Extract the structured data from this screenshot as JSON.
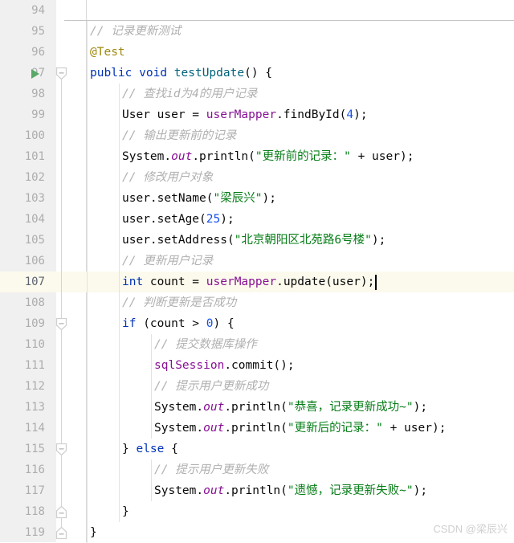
{
  "editor": {
    "language": "java",
    "theme": "IntelliJ Light",
    "current_line": 107,
    "first_visible_line": 94,
    "last_visible_line": 119,
    "colors": {
      "background": "#ffffff",
      "gutter_background": "#f0f0f0",
      "current_line_highlight": "#fcfaed",
      "line_number": "#adadad",
      "keyword": "#0033b3",
      "comment": "#b0b0b0",
      "string": "#067d17",
      "number": "#1750eb",
      "annotation": "#9e880d",
      "method": "#00627a",
      "field": "#871094",
      "static_field": "#871094",
      "text": "#080808",
      "indent_guide": "#e3e3e3",
      "run_marker": "#59a869"
    }
  },
  "gutter": {
    "run_marker_line": 97,
    "run_marker_name": "run-test-gutter-icon",
    "fold_markers": [
      {
        "line": 97,
        "state": "expanded",
        "direction": "start"
      },
      {
        "line": 109,
        "state": "expanded",
        "direction": "start"
      },
      {
        "line": 115,
        "state": "expanded",
        "direction": "middle"
      },
      {
        "line": 118,
        "state": "expanded",
        "direction": "end"
      },
      {
        "line": 119,
        "state": "expanded",
        "direction": "end"
      }
    ]
  },
  "lines": [
    {
      "number": "94",
      "indent": 0,
      "tokens": []
    },
    {
      "number": "95",
      "indent": 1,
      "tokens": [
        {
          "t": "cmt",
          "v": "// 记录更新测试"
        }
      ]
    },
    {
      "number": "96",
      "indent": 1,
      "tokens": [
        {
          "t": "anno",
          "v": "@Test"
        }
      ]
    },
    {
      "number": "97",
      "indent": 1,
      "tokens": [
        {
          "t": "kw",
          "v": "public"
        },
        {
          "t": "plain",
          "v": " "
        },
        {
          "t": "kw",
          "v": "void"
        },
        {
          "t": "plain",
          "v": " "
        },
        {
          "t": "mth",
          "v": "testUpdate"
        },
        {
          "t": "plain",
          "v": "() {"
        }
      ]
    },
    {
      "number": "98",
      "indent": 2,
      "tokens": [
        {
          "t": "cmt",
          "v": "// 查找id为4的用户记录"
        }
      ]
    },
    {
      "number": "99",
      "indent": 2,
      "tokens": [
        {
          "t": "cls",
          "v": "User"
        },
        {
          "t": "plain",
          "v": " user = "
        },
        {
          "t": "fld",
          "v": "userMapper"
        },
        {
          "t": "plain",
          "v": ".findById("
        },
        {
          "t": "num",
          "v": "4"
        },
        {
          "t": "plain",
          "v": ");"
        }
      ]
    },
    {
      "number": "100",
      "indent": 2,
      "tokens": [
        {
          "t": "cmt",
          "v": "// 输出更新前的记录"
        }
      ]
    },
    {
      "number": "101",
      "indent": 2,
      "tokens": [
        {
          "t": "plain",
          "v": "System."
        },
        {
          "t": "stat",
          "v": "out"
        },
        {
          "t": "plain",
          "v": ".println("
        },
        {
          "t": "str",
          "v": "\"更新前的记录：\""
        },
        {
          "t": "plain",
          "v": " + user);"
        }
      ]
    },
    {
      "number": "102",
      "indent": 2,
      "tokens": [
        {
          "t": "cmt",
          "v": "// 修改用户对象"
        }
      ]
    },
    {
      "number": "103",
      "indent": 2,
      "tokens": [
        {
          "t": "plain",
          "v": "user.setName("
        },
        {
          "t": "str",
          "v": "\"梁辰兴\""
        },
        {
          "t": "plain",
          "v": ");"
        }
      ]
    },
    {
      "number": "104",
      "indent": 2,
      "tokens": [
        {
          "t": "plain",
          "v": "user.setAge("
        },
        {
          "t": "num",
          "v": "25"
        },
        {
          "t": "plain",
          "v": ");"
        }
      ]
    },
    {
      "number": "105",
      "indent": 2,
      "tokens": [
        {
          "t": "plain",
          "v": "user.setAddress("
        },
        {
          "t": "str",
          "v": "\"北京朝阳区北苑路6号楼\""
        },
        {
          "t": "plain",
          "v": ");"
        }
      ]
    },
    {
      "number": "106",
      "indent": 2,
      "tokens": [
        {
          "t": "cmt",
          "v": "// 更新用户记录"
        }
      ]
    },
    {
      "number": "107",
      "indent": 2,
      "current": true,
      "tokens": [
        {
          "t": "kw",
          "v": "int"
        },
        {
          "t": "plain",
          "v": " count = "
        },
        {
          "t": "fld",
          "v": "userMapper"
        },
        {
          "t": "plain",
          "v": ".update(user);"
        }
      ]
    },
    {
      "number": "108",
      "indent": 2,
      "tokens": [
        {
          "t": "cmt",
          "v": "// 判断更新是否成功"
        }
      ]
    },
    {
      "number": "109",
      "indent": 2,
      "tokens": [
        {
          "t": "kw",
          "v": "if"
        },
        {
          "t": "plain",
          "v": " (count > "
        },
        {
          "t": "num",
          "v": "0"
        },
        {
          "t": "plain",
          "v": ") {"
        }
      ]
    },
    {
      "number": "110",
      "indent": 3,
      "tokens": [
        {
          "t": "cmt",
          "v": "// 提交数据库操作"
        }
      ]
    },
    {
      "number": "111",
      "indent": 3,
      "tokens": [
        {
          "t": "fld",
          "v": "sqlSession"
        },
        {
          "t": "plain",
          "v": ".commit();"
        }
      ]
    },
    {
      "number": "112",
      "indent": 3,
      "tokens": [
        {
          "t": "cmt",
          "v": "// 提示用户更新成功"
        }
      ]
    },
    {
      "number": "113",
      "indent": 3,
      "tokens": [
        {
          "t": "plain",
          "v": "System."
        },
        {
          "t": "stat",
          "v": "out"
        },
        {
          "t": "plain",
          "v": ".println("
        },
        {
          "t": "str",
          "v": "\"恭喜，记录更新成功~\""
        },
        {
          "t": "plain",
          "v": ");"
        }
      ]
    },
    {
      "number": "114",
      "indent": 3,
      "tokens": [
        {
          "t": "plain",
          "v": "System."
        },
        {
          "t": "stat",
          "v": "out"
        },
        {
          "t": "plain",
          "v": ".println("
        },
        {
          "t": "str",
          "v": "\"更新后的记录：\""
        },
        {
          "t": "plain",
          "v": " + user);"
        }
      ]
    },
    {
      "number": "115",
      "indent": 2,
      "tokens": [
        {
          "t": "plain",
          "v": "} "
        },
        {
          "t": "kw",
          "v": "else"
        },
        {
          "t": "plain",
          "v": " {"
        }
      ]
    },
    {
      "number": "116",
      "indent": 3,
      "tokens": [
        {
          "t": "cmt",
          "v": "// 提示用户更新失败"
        }
      ]
    },
    {
      "number": "117",
      "indent": 3,
      "tokens": [
        {
          "t": "plain",
          "v": "System."
        },
        {
          "t": "stat",
          "v": "out"
        },
        {
          "t": "plain",
          "v": ".println("
        },
        {
          "t": "str",
          "v": "\"遗憾，记录更新失败~\""
        },
        {
          "t": "plain",
          "v": ");"
        }
      ]
    },
    {
      "number": "118",
      "indent": 2,
      "tokens": [
        {
          "t": "plain",
          "v": "}"
        }
      ]
    },
    {
      "number": "119",
      "indent": 1,
      "tokens": [
        {
          "t": "plain",
          "v": "}"
        }
      ]
    }
  ],
  "watermark": {
    "text": "CSDN @梁辰兴"
  }
}
